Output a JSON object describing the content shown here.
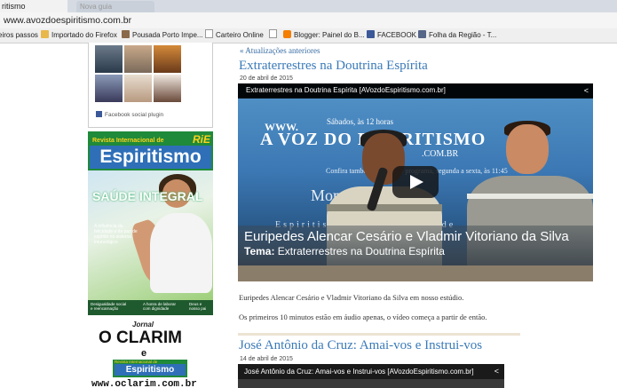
{
  "browser": {
    "tab_active": "ritismo",
    "tab_inactive": "Nova guia",
    "url": "www.avozdoespiritismo.com.br",
    "bookmarks": [
      {
        "label": "eiros passos",
        "icon": "none"
      },
      {
        "label": "Importado do Firefox",
        "icon": "folder-icon"
      },
      {
        "label": "Pousada Porto Impe...",
        "icon": "photo-icon"
      },
      {
        "label": "Carteiro Online",
        "icon": "page-icon"
      },
      {
        "label": "",
        "icon": "page-icon"
      },
      {
        "label": "Blogger: Painel do B...",
        "icon": "blogger-icon"
      },
      {
        "label": "FACEBOOK",
        "icon": "facebook-icon"
      },
      {
        "label": "Folha da Região - T...",
        "icon": "folha-icon"
      }
    ]
  },
  "sidebar": {
    "fb_plugin_label": "Facebook social plugin",
    "magazine": {
      "rie": "RiE",
      "revista": "Revista Internacional de",
      "espiritismo": "Espiritismo",
      "saude": "SAÚDE INTEGRAL",
      "saude_sub": "A influência da felicidade e da paz de espírito no sistema imunológico",
      "bottom_1": "Desigualdade social e reencarnação",
      "bottom_2": "A honra de laborar com dignidade",
      "bottom_3": "Deus e nosso pai",
      "jornal": "Jornal",
      "clarim": "O CLARIM",
      "e": "e",
      "rev_top": "Revista Internacional de",
      "rev_esp": "Espiritismo",
      "site": "www.oclarim.com.br"
    }
  },
  "main": {
    "prev_link": "« Atualizações anteriores",
    "post1": {
      "title": "Extraterrestres na Doutrina Espírita",
      "date": "20 de abril de 2015",
      "video_title": "Extraterrestres na Doutrina Espírita [AVozdoEspiritismo.com.br]",
      "wm_site": "WWW.",
      "wm_time": "Sábados, às 12 horas",
      "wm_brand": "A VOZ DO ESPIRITISMO",
      "wm_com": ".COM.BR",
      "wm_confira": "Confira também o próximo programa, segunda a sexta, às 11:45",
      "wm_momento": "Momento Espírita",
      "wm_espirit": "Espiritismo Responsabilidade",
      "names": "Euripedes Alencar Cesário e Vladmir Vitoriano da Silva",
      "tema_label": "Tema:",
      "tema": "Extraterrestres na Doutrina Espírita",
      "text1": "Euripedes Alencar Cesário e Vladmir Vitoriano da Silva em nosso estúdio.",
      "text2": "Os primeiros 10 minutos estão em áudio apenas, o vídeo começa a partir de então."
    },
    "post2": {
      "title": "José Antônio da Cruz: Amai-vos e Instrui-vos",
      "date": "14 de abril de 2015",
      "video_title": "José Antônio da Cruz: Amai-vos e Instrui-vos [AVozdoEspiritismo.com.br]"
    }
  }
}
